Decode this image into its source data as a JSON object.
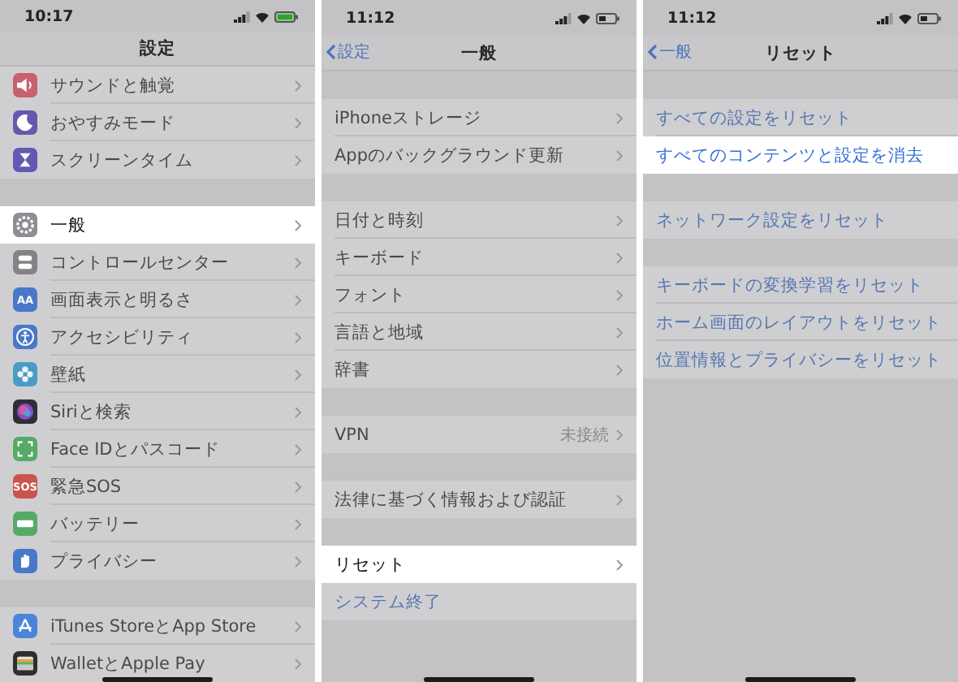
{
  "screens": [
    {
      "status_bar": {
        "time": "10:17",
        "charging": true
      },
      "nav": {
        "title": "設定"
      },
      "groups": [
        [
          {
            "label": "サウンドと触覚",
            "kind": "nav",
            "selected": false,
            "color": "#c9606e"
          },
          {
            "label": "おやすみモード",
            "kind": "nav",
            "selected": false,
            "color": "#6359b0"
          },
          {
            "label": "スクリーンタイム",
            "kind": "nav",
            "selected": false,
            "color": "#6359b0"
          }
        ],
        [
          {
            "label": "一般",
            "kind": "nav",
            "selected": true,
            "color": "#8e8e93"
          },
          {
            "label": "コントロールセンター",
            "kind": "nav",
            "selected": false,
            "color": "#838387"
          },
          {
            "label": "画面表示と明るさ",
            "kind": "nav",
            "selected": false,
            "color": "#4a78c8",
            "icon_text": "AA"
          },
          {
            "label": "アクセシビリティ",
            "kind": "nav",
            "selected": false,
            "color": "#4a78c8"
          },
          {
            "label": "壁紙",
            "kind": "nav",
            "selected": false,
            "color": "#4a9cc4"
          },
          {
            "label": "Siriと検索",
            "kind": "nav",
            "selected": false,
            "color": "#2e2e3a"
          },
          {
            "label": "Face IDとパスコード",
            "kind": "nav",
            "selected": false,
            "color": "#56aa66"
          },
          {
            "label": "緊急SOS",
            "kind": "nav",
            "selected": false,
            "color": "#c9544c",
            "icon_text": "SOS"
          },
          {
            "label": "バッテリー",
            "kind": "nav",
            "selected": false,
            "color": "#56aa66"
          },
          {
            "label": "プライバシー",
            "kind": "nav",
            "selected": false,
            "color": "#4a78c8"
          }
        ],
        [
          {
            "label": "iTunes StoreとApp Store",
            "kind": "nav",
            "selected": false,
            "color": "#4a86d8"
          },
          {
            "label": "WalletとApple Pay",
            "kind": "nav",
            "selected": false,
            "color": "#2e2e30"
          }
        ]
      ]
    },
    {
      "status_bar": {
        "time": "11:12",
        "charging": false
      },
      "nav": {
        "back": "設定",
        "title": "一般"
      },
      "groups": [
        [
          {
            "label": "iPhoneストレージ",
            "kind": "nav",
            "selected": false
          },
          {
            "label": "Appのバックグラウンド更新",
            "kind": "nav",
            "selected": false
          }
        ],
        [
          {
            "label": "日付と時刻",
            "kind": "nav",
            "selected": false
          },
          {
            "label": "キーボード",
            "kind": "nav",
            "selected": false
          },
          {
            "label": "フォント",
            "kind": "nav",
            "selected": false
          },
          {
            "label": "言語と地域",
            "kind": "nav",
            "selected": false
          },
          {
            "label": "辞書",
            "kind": "nav",
            "selected": false
          }
        ],
        [
          {
            "label": "VPN",
            "kind": "nav",
            "selected": false,
            "value": "未接続"
          }
        ],
        [
          {
            "label": "法律に基づく情報および認証",
            "kind": "nav",
            "selected": false
          }
        ],
        [
          {
            "label": "リセット",
            "kind": "nav",
            "selected": true
          },
          {
            "label": "システム終了",
            "kind": "action",
            "selected": false
          }
        ]
      ]
    },
    {
      "status_bar": {
        "time": "11:12",
        "charging": false
      },
      "nav": {
        "back": "一般",
        "title": "リセット"
      },
      "groups": [
        [
          {
            "label": "すべての設定をリセット",
            "kind": "action",
            "selected": false
          },
          {
            "label": "すべてのコンテンツと設定を消去",
            "kind": "action",
            "selected": true
          }
        ],
        [
          {
            "label": "ネットワーク設定をリセット",
            "kind": "action",
            "selected": false
          }
        ],
        [
          {
            "label": "キーボードの変換学習をリセット",
            "kind": "action",
            "selected": false
          },
          {
            "label": "ホーム画面のレイアウトをリセット",
            "kind": "action",
            "selected": false
          },
          {
            "label": "位置情報とプライバシーをリセット",
            "kind": "action",
            "selected": false
          }
        ]
      ]
    }
  ]
}
